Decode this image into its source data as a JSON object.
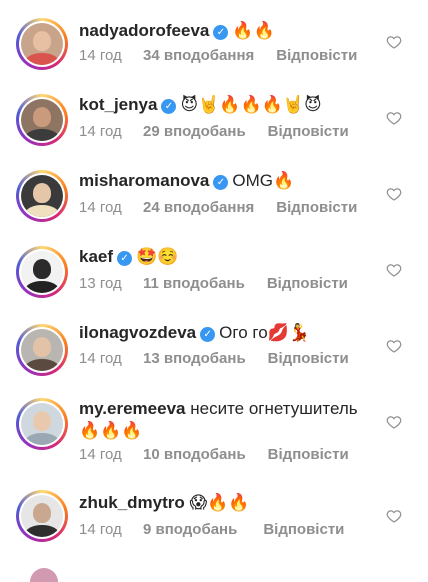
{
  "comments": [
    {
      "username": "nadyadorofeeva",
      "verified": true,
      "text": "🔥🔥",
      "time": "14 год",
      "likes": "34 вподобання",
      "reply": "Відповісти"
    },
    {
      "username": "kot_jenya",
      "verified": true,
      "text": "😈🤘🔥🔥🔥🤘😈",
      "time": "14 год",
      "likes": "29 вподобань",
      "reply": "Відповісти"
    },
    {
      "username": "misharomanova",
      "verified": true,
      "text": "OMG🔥",
      "time": "14 год",
      "likes": "24 вподобання",
      "reply": "Відповісти"
    },
    {
      "username": "kaef",
      "verified": true,
      "text": "🤩☺️",
      "time": "13 год",
      "likes": "11 вподобань",
      "reply": "Відповісти"
    },
    {
      "username": "ilonagvozdeva",
      "verified": true,
      "text": "Ого го💋💃",
      "time": "14 год",
      "likes": "13 вподобань",
      "reply": "Відповісти"
    },
    {
      "username": "my.eremeeva",
      "verified": false,
      "text": "несите огнетушитель🔥🔥🔥",
      "time": "14 год",
      "likes": "10 вподобань",
      "reply": "Відповісти"
    },
    {
      "username": "zhuk_dmytro",
      "verified": false,
      "text": "😱🔥🔥",
      "time": "14 год",
      "likes": "9 вподобань",
      "reply": "Відповісти"
    }
  ],
  "icons": {
    "verified": "verified-badge-icon",
    "like": "heart-outline-icon"
  },
  "colors": {
    "verified": "#3897f0",
    "secondary": "#8e8e8e",
    "ring_start": "#feda75",
    "ring_end": "#d62976"
  }
}
